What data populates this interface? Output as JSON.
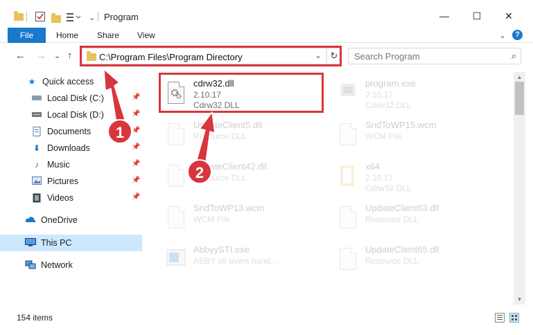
{
  "window": {
    "title": "Program",
    "minimize": "—",
    "maximize": "☐",
    "close": "✕"
  },
  "ribbon": {
    "tabs": [
      "File",
      "Home",
      "Share",
      "View"
    ],
    "expand": "⌄",
    "help": "?"
  },
  "navigation": {
    "back": "←",
    "forward": "→",
    "recent": "⌄",
    "up": "↑",
    "address": "C:\\Program Files\\Program Directory",
    "refresh": "↻",
    "search_placeholder": "Search Program"
  },
  "sidebar": {
    "items": [
      {
        "label": "Quick access",
        "icon": "star-icon",
        "pinned": false
      },
      {
        "label": "Local Disk (C:)",
        "icon": "drive-icon",
        "pinned": true
      },
      {
        "label": "Local Disk (D:)",
        "icon": "drive-icon",
        "pinned": true
      },
      {
        "label": "Documents",
        "icon": "documents-icon",
        "pinned": true
      },
      {
        "label": "Downloads",
        "icon": "download-icon",
        "pinned": true
      },
      {
        "label": "Music",
        "icon": "music-icon",
        "pinned": true
      },
      {
        "label": "Pictures",
        "icon": "pictures-icon",
        "pinned": true
      },
      {
        "label": "Videos",
        "icon": "videos-icon",
        "pinned": true
      },
      {
        "label": "OneDrive",
        "icon": "cloud-icon",
        "pinned": false
      },
      {
        "label": "This PC",
        "icon": "computer-icon",
        "pinned": false,
        "selected": true
      },
      {
        "label": "Network",
        "icon": "network-icon",
        "pinned": false
      }
    ]
  },
  "files": [
    {
      "name": "cdrw32.dll",
      "line1": "2.10.17",
      "line2": "Cdrw32 DLL",
      "icon": "dll-gear-icon",
      "highlighted": true
    },
    {
      "name": "program.exe",
      "line1": "2.10.17",
      "line2": "Cdrw32 DLL",
      "icon": "exe-icon"
    },
    {
      "name": "UpdateClient5.dll",
      "line1": "Resource DLL",
      "line2": "",
      "icon": "dll-gear-icon"
    },
    {
      "name": "SndToWP15.wcm",
      "line1": "WCM File",
      "line2": "",
      "icon": "document-icon"
    },
    {
      "name": "UpdateClient42.dll",
      "line1": "Resource DLL",
      "line2": "",
      "icon": "dll-gear-icon"
    },
    {
      "name": "x64",
      "line1": "2.10.17",
      "line2": "Cdrw32 DLL",
      "icon": "folder-doc-icon"
    },
    {
      "name": "SndToWP13.wcm",
      "line1": "WCM File",
      "line2": "",
      "icon": "document-icon"
    },
    {
      "name": "UpdateClient63.dll",
      "line1": "Resource DLL",
      "line2": "",
      "icon": "dll-gear-icon"
    },
    {
      "name": "AbbyySTI.exe",
      "line1": "ABBY s6 avent hand...",
      "line2": "",
      "icon": "window-icon"
    },
    {
      "name": "UpdateClient65.dll",
      "line1": "Resource DLL",
      "line2": "",
      "icon": "dll-gear-icon"
    }
  ],
  "status": {
    "item_count": "154 items"
  },
  "annotations": {
    "marker1": "1",
    "marker2": "2",
    "color": "#d9353c"
  },
  "colors": {
    "accent": "#1979ca",
    "selection": "#cce8ff"
  }
}
